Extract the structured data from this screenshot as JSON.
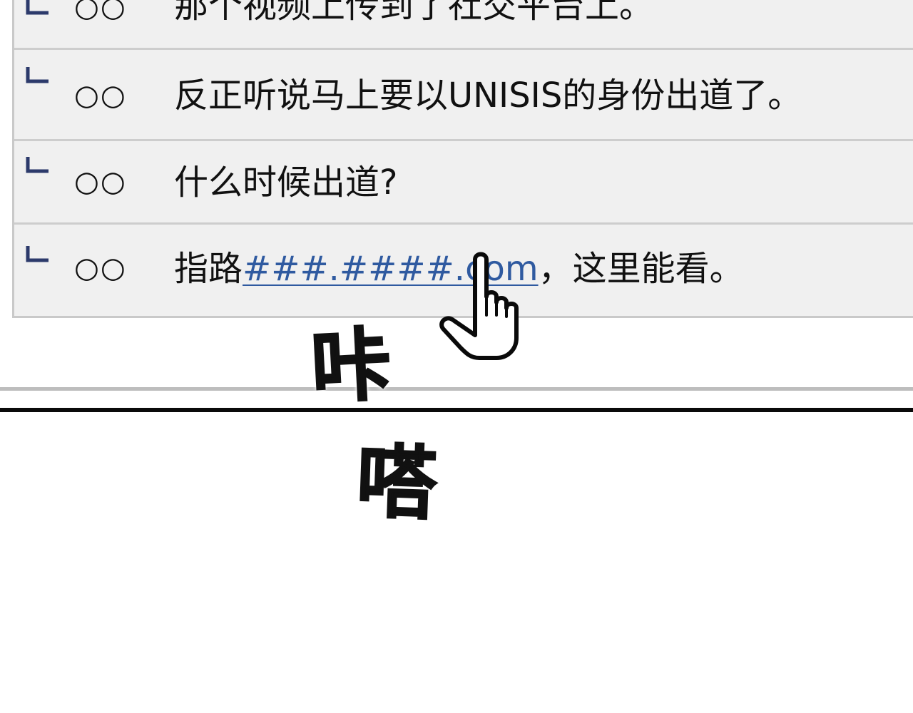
{
  "replies": [
    {
      "user": "○○",
      "text": "那个视频上传到了社交平台上。"
    },
    {
      "user": "○○",
      "text": "反正听说马上要以UNISIS的身份出道了。"
    },
    {
      "user": "○○",
      "text": "什么时候出道?"
    },
    {
      "user": "○○",
      "text_before": "指路",
      "link": "###.####.com",
      "text_after": "，这里能看。"
    }
  ],
  "sound_effects": [
    "咔",
    "嗒"
  ],
  "cursor": {
    "icon": "pointing-hand-cursor-icon"
  },
  "colors": {
    "panel_bg": "#f0f0f0",
    "row_border": "#cdcdcd",
    "reply_marker": "#2c3a6b",
    "link": "#2f5aa0",
    "text": "#111111"
  }
}
